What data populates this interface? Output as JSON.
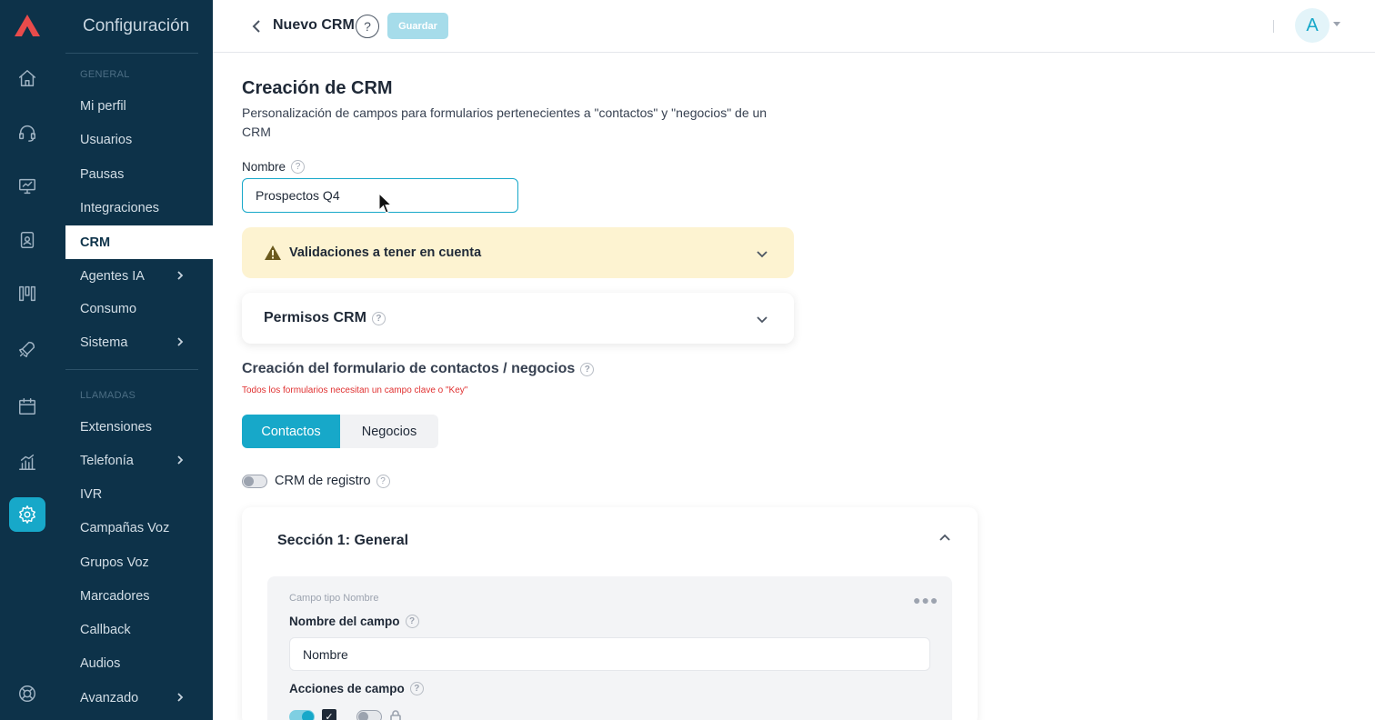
{
  "sidebar": {
    "title": "Configuración",
    "group_general": "GENERAL",
    "group_calls": "LLAMADAS",
    "items": [
      {
        "label": "Mi perfil"
      },
      {
        "label": "Usuarios"
      },
      {
        "label": "Pausas"
      },
      {
        "label": "Integraciones"
      },
      {
        "label": "CRM",
        "active": true
      },
      {
        "label": "Agentes IA"
      },
      {
        "label": "Consumo"
      },
      {
        "label": "Sistema"
      },
      {
        "label": "Extensiones"
      },
      {
        "label": "Telefonía"
      },
      {
        "label": "IVR"
      },
      {
        "label": "Campañas Voz"
      },
      {
        "label": "Grupos Voz"
      },
      {
        "label": "Marcadores"
      },
      {
        "label": "Callback"
      },
      {
        "label": "Audios"
      },
      {
        "label": "Avanzado"
      }
    ]
  },
  "rail_icons": [
    "home-icon",
    "headset-icon",
    "monitor-icon",
    "badge-icon",
    "board-icon",
    "rocket-icon",
    "calendar-icon",
    "chart-icon",
    "gear-icon",
    "lifebuoy-icon"
  ],
  "topbar": {
    "title": "Nuevo CRM",
    "help": "?",
    "save_label": "Guardar",
    "avatar_initial": "A"
  },
  "main": {
    "title": "Creación de CRM",
    "description": "Personalización de campos para formularios pertenecientes a \"contactos\" y \"negocios\" de un CRM",
    "name_label": "Nombre",
    "name_value": "Prospectos Q4",
    "validations_label": "Validaciones a tener en cuenta",
    "permissions_label": "Permisos CRM",
    "form_title": "Creación del formulario de contactos / negocios",
    "form_error": "Todos los formularios necesitan un campo clave o \"Key\"",
    "tabs": [
      {
        "label": "Contactos",
        "active": true
      },
      {
        "label": "Negocios"
      }
    ],
    "register_toggle_label": "CRM de registro",
    "section": {
      "title": "Sección 1: General",
      "field_type": "Campo tipo Nombre",
      "field_name_label": "Nombre del campo",
      "field_name_value": "Nombre",
      "field_actions_label": "Acciones de campo"
    }
  },
  "colors": {
    "sidebar_bg": "#0d3249",
    "accent": "#17a8c9",
    "warning_bg": "#fdf3d1",
    "error": "#e03131"
  }
}
